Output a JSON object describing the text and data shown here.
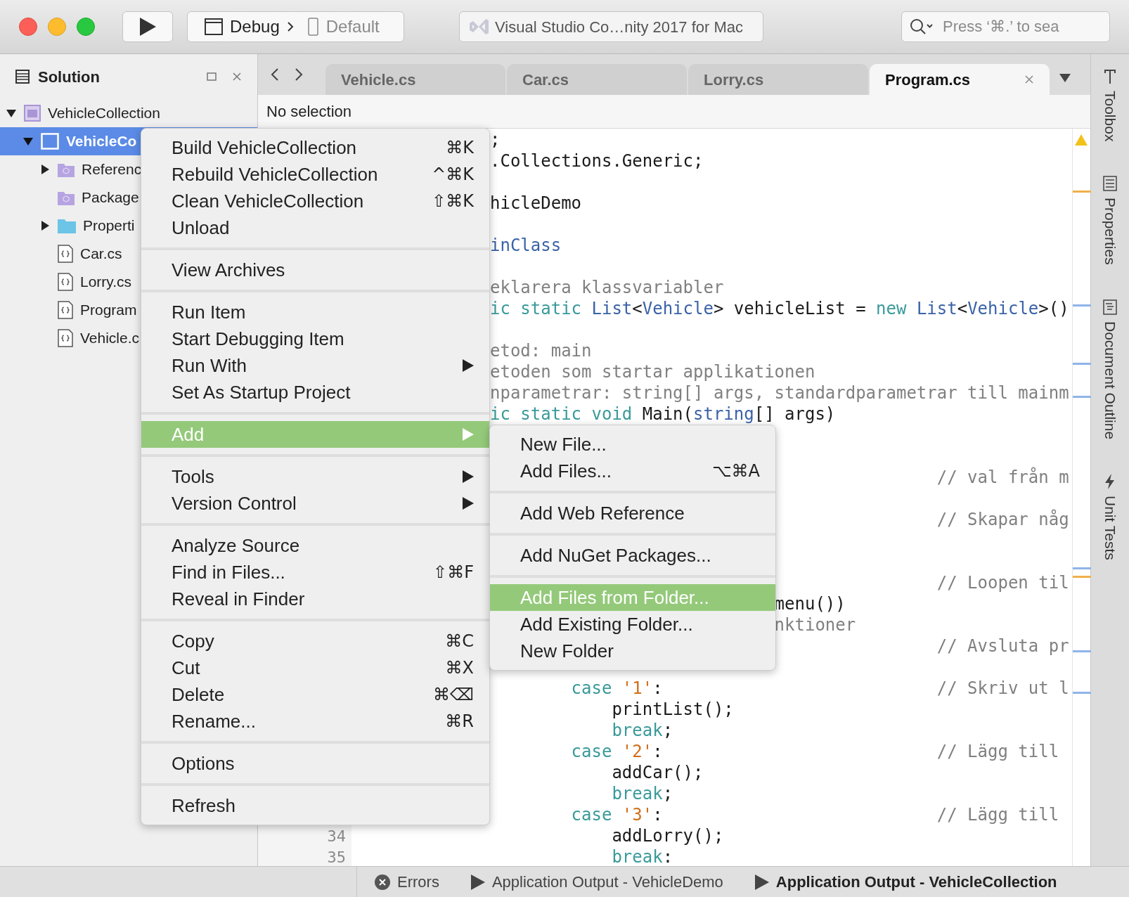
{
  "toolbar": {
    "run_config": "Debug",
    "device": "Default",
    "status": "Visual Studio Co…nity 2017 for Mac",
    "search": {
      "placeholder": "Press ‘⌘.’ to sea"
    }
  },
  "solution_pad": {
    "title": "Solution",
    "tree": [
      {
        "label": "VehicleCollection",
        "kind": "solution",
        "expanded": true,
        "selected": false,
        "children": [
          {
            "label": "VehicleCo",
            "kind": "project",
            "expanded": true,
            "selected": true,
            "children": [
              {
                "label": "Referenc",
                "kind": "references",
                "expanded": false,
                "selected": false
              },
              {
                "label": "Package",
                "kind": "packages",
                "selected": false
              },
              {
                "label": "Properti",
                "kind": "folder",
                "expanded": false,
                "selected": false
              },
              {
                "label": "Car.cs",
                "kind": "file",
                "selected": false
              },
              {
                "label": "Lorry.cs",
                "kind": "file",
                "selected": false
              },
              {
                "label": "Program",
                "kind": "file",
                "selected": false
              },
              {
                "label": "Vehicle.c",
                "kind": "file",
                "selected": false
              }
            ]
          }
        ]
      }
    ]
  },
  "tabs": [
    {
      "label": "Vehicle.cs",
      "selected": false
    },
    {
      "label": "Car.cs",
      "selected": false
    },
    {
      "label": "Lorry.cs",
      "selected": false
    },
    {
      "label": "Program.cs",
      "selected": true
    }
  ],
  "breadcrumb": "No selection",
  "code_lines": [
    {
      "kind": "cut",
      "segments": [
        {
          "text": ";",
          "kind": "plain"
        }
      ]
    },
    {
      "kind": "cut",
      "segments": [
        {
          "text": ".Collections.Generic;",
          "kind": "plain"
        }
      ]
    },
    {
      "kind": "blank"
    },
    {
      "kind": "cut",
      "segments": [
        {
          "text": "hicleDemo",
          "kind": "plain"
        }
      ]
    },
    {
      "kind": "blank"
    },
    {
      "kind": "cut",
      "segments": [
        {
          "text": "inClass",
          "kind": "type"
        }
      ]
    },
    {
      "kind": "blank"
    },
    {
      "kind": "cut",
      "segments": [
        {
          "text": "eklarera klassvariabler",
          "kind": "comment"
        }
      ]
    },
    {
      "kind": "cut",
      "segments": [
        {
          "text": "ic static",
          "kind": "keyword"
        },
        {
          "text": " List",
          "kind": "type"
        },
        {
          "text": "<",
          "kind": "plain"
        },
        {
          "text": "Vehicle",
          "kind": "type"
        },
        {
          "text": "> vehicleList = ",
          "kind": "plain"
        },
        {
          "text": "new",
          "kind": "keyword"
        },
        {
          "text": " List",
          "kind": "type"
        },
        {
          "text": "<",
          "kind": "plain"
        },
        {
          "text": "Vehicle",
          "kind": "type"
        },
        {
          "text": ">()",
          "kind": "plain"
        }
      ]
    },
    {
      "kind": "blank"
    },
    {
      "kind": "cut",
      "segments": [
        {
          "text": "etod: main",
          "kind": "comment"
        }
      ]
    },
    {
      "kind": "cut",
      "segments": [
        {
          "text": "etoden som startar applikationen",
          "kind": "comment"
        }
      ]
    },
    {
      "kind": "cut",
      "segments": [
        {
          "text": "nparametrar: string[] args, standardparametrar till mainm",
          "kind": "comment"
        }
      ]
    },
    {
      "kind": "cut",
      "segments": [
        {
          "text": "ic static void",
          "kind": "keyword"
        },
        {
          "text": " Main(",
          "kind": "plain"
        },
        {
          "text": "string",
          "kind": "type"
        },
        {
          "text": "[] args)",
          "kind": "plain"
        }
      ]
    },
    {
      "kind": "blank"
    },
    {
      "kind": "blank"
    },
    {
      "kind": "blank",
      "comment": "// val från m"
    },
    {
      "kind": "blank"
    },
    {
      "kind": "blank",
      "comment": "// Skapar någ"
    },
    {
      "kind": "blank"
    },
    {
      "kind": "blank"
    },
    {
      "kind": "blank",
      "comment": "// Loopen til"
    },
    {
      "kind": "tail",
      "segments": [
        {
          "text": "menu())",
          "kind": "plain"
        }
      ]
    },
    {
      "kind": "tail",
      "segments": [
        {
          "text": "nktioner",
          "kind": "comment"
        }
      ]
    },
    {
      "kind": "blank",
      "comment": "// Avsluta pr"
    },
    {
      "kind": "blank"
    },
    {
      "kind": "case",
      "segments": [
        {
          "text": "case",
          "kind": "keyword"
        },
        {
          "text": " '1'",
          "kind": "string"
        },
        {
          "text": ":",
          "kind": "plain"
        }
      ],
      "comment": "// Skriv ut l"
    },
    {
      "kind": "statement",
      "segments": [
        {
          "text": "printList();",
          "kind": "plain"
        }
      ]
    },
    {
      "kind": "statement",
      "segments": [
        {
          "text": "break",
          "kind": "keyword"
        },
        {
          "text": ";",
          "kind": "plain"
        }
      ]
    },
    {
      "kind": "case",
      "segments": [
        {
          "text": "case",
          "kind": "keyword"
        },
        {
          "text": " '2'",
          "kind": "string"
        },
        {
          "text": ":",
          "kind": "plain"
        }
      ],
      "comment": "// Lägg till"
    },
    {
      "kind": "statement",
      "segments": [
        {
          "text": "addCar();",
          "kind": "plain"
        }
      ]
    },
    {
      "kind": "statement",
      "segments": [
        {
          "text": "break",
          "kind": "keyword"
        },
        {
          "text": ";",
          "kind": "plain"
        }
      ]
    },
    {
      "kind": "case",
      "segments": [
        {
          "text": "case",
          "kind": "keyword"
        },
        {
          "text": " '3'",
          "kind": "string"
        },
        {
          "text": ":",
          "kind": "plain"
        }
      ],
      "comment": "// Lägg till"
    },
    {
      "kind": "statement",
      "line_number": "34",
      "segments": [
        {
          "text": "addLorry();",
          "kind": "plain"
        }
      ]
    },
    {
      "kind": "statement",
      "line_number": "35",
      "segments": [
        {
          "text": "break",
          "kind": "keyword"
        },
        {
          "text": ":",
          "kind": "plain"
        }
      ]
    }
  ],
  "side_pads": [
    {
      "label": "Toolbox"
    },
    {
      "label": "Properties"
    },
    {
      "label": "Document Outline"
    },
    {
      "label": "Unit Tests"
    }
  ],
  "context_menu": {
    "groups": [
      [
        {
          "label": "Build VehicleCollection",
          "shortcut": "⌘K",
          "submenu": false,
          "selected": false
        },
        {
          "label": "Rebuild VehicleCollection",
          "shortcut": "^⌘K",
          "submenu": false,
          "selected": false
        },
        {
          "label": "Clean VehicleCollection",
          "shortcut": "⇧⌘K",
          "submenu": false,
          "selected": false
        },
        {
          "label": "Unload",
          "submenu": false,
          "selected": false
        }
      ],
      [
        {
          "label": "View Archives",
          "submenu": false,
          "selected": false
        }
      ],
      [
        {
          "label": "Run Item",
          "submenu": false,
          "selected": false
        },
        {
          "label": "Start Debugging Item",
          "submenu": false,
          "selected": false
        },
        {
          "label": "Run With",
          "submenu": true,
          "selected": false
        },
        {
          "label": "Set As Startup Project",
          "submenu": false,
          "selected": false
        }
      ],
      [
        {
          "label": "Add",
          "submenu": true,
          "selected": true
        }
      ],
      [
        {
          "label": "Tools",
          "submenu": true,
          "selected": false
        },
        {
          "label": "Version Control",
          "submenu": true,
          "selected": false
        }
      ],
      [
        {
          "label": "Analyze Source",
          "submenu": false,
          "selected": false
        },
        {
          "label": "Find in Files...",
          "shortcut": "⇧⌘F",
          "submenu": false,
          "selected": false
        },
        {
          "label": "Reveal in Finder",
          "submenu": false,
          "selected": false
        }
      ],
      [
        {
          "label": "Copy",
          "shortcut": "⌘C",
          "submenu": false,
          "selected": false
        },
        {
          "label": "Cut",
          "shortcut": "⌘X",
          "submenu": false,
          "selected": false
        },
        {
          "label": "Delete",
          "shortcut": "⌘⌫",
          "submenu": false,
          "selected": false
        },
        {
          "label": "Rename...",
          "shortcut": "⌘R",
          "submenu": false,
          "selected": false
        }
      ],
      [
        {
          "label": "Options",
          "submenu": false,
          "selected": false
        }
      ],
      [
        {
          "label": "Refresh",
          "submenu": false,
          "selected": false
        }
      ]
    ]
  },
  "submenu": {
    "groups": [
      [
        {
          "label": "New File...",
          "selected": false
        },
        {
          "label": "Add Files...",
          "shortcut": "⌥⌘A",
          "selected": false
        }
      ],
      [
        {
          "label": "Add Web Reference",
          "selected": false
        }
      ],
      [
        {
          "label": "Add NuGet Packages...",
          "selected": false
        }
      ],
      [
        {
          "label": "Add Files from Folder...",
          "selected": true
        },
        {
          "label": "Add Existing Folder...",
          "selected": false
        },
        {
          "label": "New Folder",
          "selected": false
        }
      ]
    ]
  },
  "output_bar": [
    {
      "label": "Errors",
      "kind": "errors",
      "selected": false
    },
    {
      "label": "Application Output - VehicleDemo",
      "kind": "output",
      "selected": false
    },
    {
      "label": "Application Output - VehicleCollection",
      "kind": "output",
      "selected": true
    }
  ]
}
